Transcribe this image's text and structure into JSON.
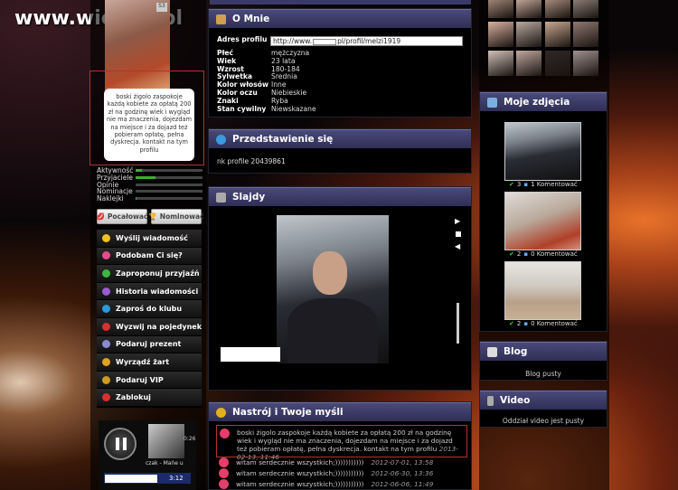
{
  "watermark": "www.wiocha.pl",
  "profile_bubble": "boski żigolo zaspokoje każdą kobiete za opłatą 200 zł na godzinę wiek i wygląd nie ma znaczenia, dojezdam na miejsce i za dojazd też pobieram opłatę, pełna dyskrecja. kontakt na tym profilu",
  "stats": [
    {
      "label": "Aktywność",
      "value": 0.1
    },
    {
      "label": "Przyjaciele",
      "value": 0.3
    },
    {
      "label": "Opinie",
      "value": 0
    },
    {
      "label": "Nominacje",
      "value": 0
    },
    {
      "label": "Naklejki",
      "value": 0.02
    }
  ],
  "actions": {
    "kiss": "Pocałować",
    "nominate": "Nominować"
  },
  "menu": [
    {
      "label": "Wyślij wiadomość",
      "icon": "envelope-icon",
      "color": "#f0c020"
    },
    {
      "label": "Podobam Ci się?",
      "icon": "heart-icon",
      "color": "#e84a8a"
    },
    {
      "label": "Zaproponuj przyjaźń",
      "icon": "plus-icon",
      "color": "#3cb83c"
    },
    {
      "label": "Historia wiadomości",
      "icon": "history-icon",
      "color": "#9a5ad0"
    },
    {
      "label": "Zaproś do klubu",
      "icon": "globe-icon",
      "color": "#2a9ad8"
    },
    {
      "label": "Wyzwij na pojedynek",
      "icon": "duel-icon",
      "color": "#d83030"
    },
    {
      "label": "Podaruj prezent",
      "icon": "gift-icon",
      "color": "#8a8ad0"
    },
    {
      "label": "Wyrządź żart",
      "icon": "joke-icon",
      "color": "#e0a020"
    },
    {
      "label": "Podaruj VIP",
      "icon": "vip-icon",
      "color": "#d09a20"
    },
    {
      "label": "Zablokuj",
      "icon": "block-icon",
      "color": "#d83030"
    }
  ],
  "player": {
    "caption": "czak - Mańe u",
    "time1": "0:26",
    "time2": "3:12"
  },
  "about": {
    "title": "O Mnie",
    "url_label": "Adres profilu",
    "url_prefix": "http://www.",
    "url_suffix": "pl/profil/melzi1919",
    "rows": [
      {
        "k": "Płeć",
        "v": "mężczyzna"
      },
      {
        "k": "Wiek",
        "v": "23 lata"
      },
      {
        "k": "Wzrost",
        "v": "180-184"
      },
      {
        "k": "Sylwetka",
        "v": "Średnia"
      },
      {
        "k": "Kolor włosów",
        "v": "Inne"
      },
      {
        "k": "Kolor oczu",
        "v": "Niebieskie"
      },
      {
        "k": "Znaki",
        "v": "Ryba"
      },
      {
        "k": "Stan cywilny",
        "v": "Niewskazane"
      }
    ]
  },
  "intro": {
    "title": "Przedstawienie się",
    "text": "nk profile 20439861"
  },
  "slides": {
    "title": "Slajdy"
  },
  "mood": {
    "title": "Nastrój i Twoje myśli",
    "highlight": {
      "text": "boski żigolo zaspokoje każdą kobiete za opłatą 200 zł na godzinę wiek i wygląd nie ma znaczenia, dojezdam na miejsce i za dojazd też pobieram opłatę, pełna dyskrecja. kontakt na tym profilu",
      "date": "2013-02-13, 11:46"
    },
    "entries": [
      {
        "text": "witam serdecznie wszystkich;)))))))))))",
        "date": "2012-07-01, 13:58"
      },
      {
        "text": "witam serdecznie wszystkich;)))))))))))",
        "date": "2012-06-30, 13:36"
      },
      {
        "text": "witam serdecznie wszystkich;)))))))))))",
        "date": "2012-06-06, 11:49"
      }
    ]
  },
  "photos": {
    "title": "Moje zdjęcia",
    "items": [
      {
        "likes": "3",
        "comments": "1 Komentować"
      },
      {
        "likes": "2",
        "comments": "0 Komentować"
      },
      {
        "likes": "2",
        "comments": "0 Komentować"
      }
    ]
  },
  "blog": {
    "title": "Blog",
    "empty": "Blog pusty"
  },
  "video": {
    "title": "Video",
    "empty": "Oddział video jest pusty"
  }
}
